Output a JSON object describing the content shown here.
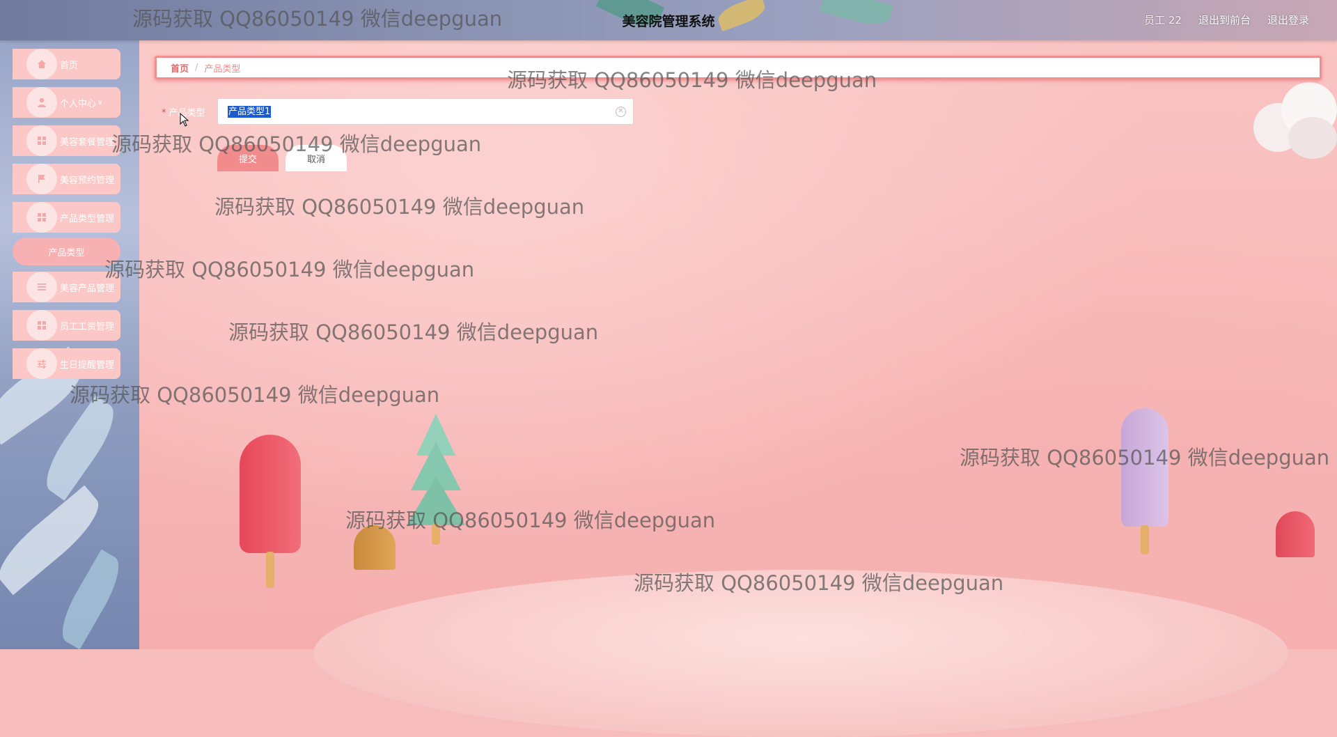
{
  "header": {
    "title": "美容院管理系统",
    "user": "员工 22",
    "back_frontend": "退出到前台",
    "logout": "退出登录"
  },
  "sidebar": {
    "items": [
      {
        "label": "首页",
        "icon": "home-icon"
      },
      {
        "label": "个人中心",
        "icon": "user-icon",
        "chevron": "chevron-down-icon"
      },
      {
        "label": "美容套餐管理",
        "icon": "grid-icon"
      },
      {
        "label": "美容预约管理",
        "icon": "flag-icon"
      },
      {
        "label": "产品类型管理",
        "icon": "grid-icon"
      },
      {
        "label": "美容产品管理",
        "icon": "list-icon"
      },
      {
        "label": "员工工资管理",
        "icon": "grid-icon"
      },
      {
        "label": "生日提醒管理",
        "icon": "sliders-icon"
      }
    ],
    "submenu": {
      "label": "产品类型"
    }
  },
  "breadcrumb": {
    "home": "首页",
    "separator": "/",
    "current": "产品类型"
  },
  "form": {
    "label": "产品类型",
    "required_mark": "*",
    "value": "产品类型1",
    "submit": "提交",
    "cancel": "取消"
  },
  "watermarks": [
    "源码获取 QQ86050149 微信deepguan",
    "源码获取 QQ86050149 微信deepguan",
    "源码获取 QQ86050149 微信deepguan",
    "源码获取 QQ86050149 微信deepguan",
    "源码获取 QQ86050149 微信deepguan",
    "源码获取 QQ86050149 微信deepguan",
    "源码获取 QQ86050149 微信deepguan",
    "源码获取 QQ86050149 微信deepguan",
    "源码获取 QQ86050149 微信deepguan",
    "源码获取 QQ86050149 微信deepguan"
  ],
  "colors": {
    "accent": "#f28c8c",
    "sidebar_item": "#fcc8c7",
    "selection": "#1a5bd0"
  }
}
